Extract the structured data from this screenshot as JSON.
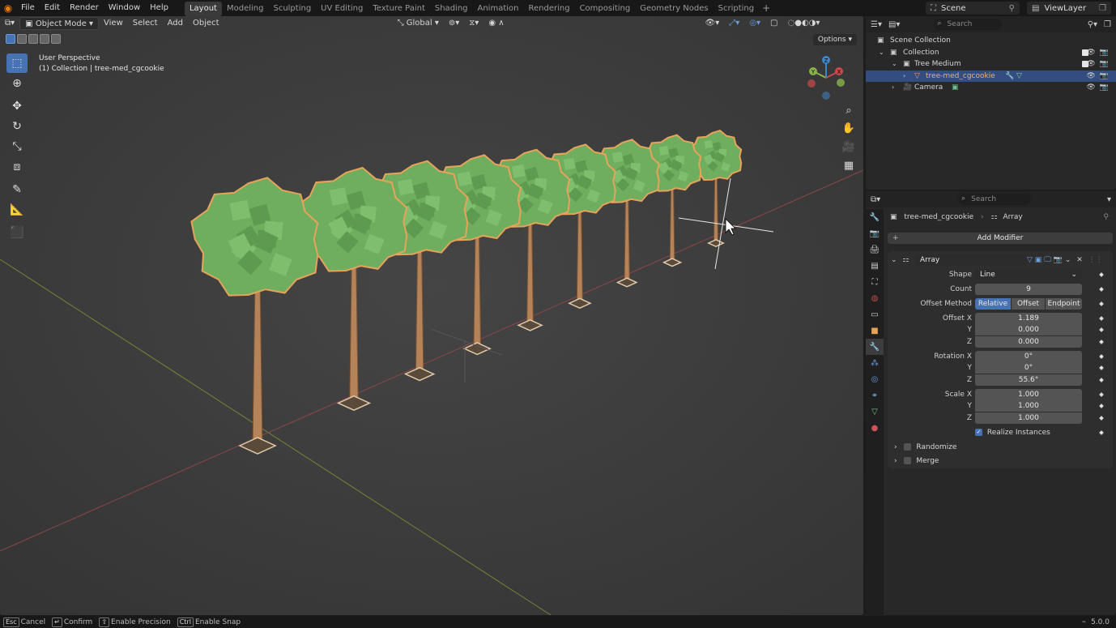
{
  "topbar": {
    "menus": [
      "File",
      "Edit",
      "Render",
      "Window",
      "Help"
    ],
    "workspaces": [
      "Layout",
      "Modeling",
      "Sculpting",
      "UV Editing",
      "Texture Paint",
      "Shading",
      "Animation",
      "Rendering",
      "Compositing",
      "Geometry Nodes",
      "Scripting"
    ],
    "active_workspace": "Layout",
    "add_symbol": "+",
    "scene": "Scene",
    "view_layer": "ViewLayer"
  },
  "viewport": {
    "mode": "Object Mode",
    "menus": [
      "View",
      "Select",
      "Add",
      "Object"
    ],
    "transform_orientation": "Global",
    "options": "Options",
    "info_line1": "User Perspective",
    "info_line2": "(1) Collection | tree-med_cgcookie",
    "gizmo_axes": [
      "X",
      "Y",
      "Z"
    ]
  },
  "outliner": {
    "search_placeholder": "Search",
    "rows": [
      {
        "label": "Scene Collection"
      },
      {
        "label": "Collection"
      },
      {
        "label": "Tree Medium"
      },
      {
        "label": "tree-med_cgcookie"
      },
      {
        "label": "Camera"
      }
    ]
  },
  "properties": {
    "search_placeholder": "Search",
    "breadcrumb_object": "tree-med_cgcookie",
    "breadcrumb_modifier": "Array",
    "add_modifier": "Add Modifier",
    "modifier_name": "Array",
    "shape_label": "Shape",
    "shape_value": "Line",
    "count_label": "Count",
    "count_value": "9",
    "offset_method_label": "Offset Method",
    "offset_methods": [
      "Relative",
      "Offset",
      "Endpoint"
    ],
    "offset_label_x": "Offset X",
    "offset_x": "1.189",
    "offset_y": "0.000",
    "offset_z": "0.000",
    "rotation_label_x": "Rotation X",
    "rotation_x": "0°",
    "rotation_y": "0°",
    "rotation_z": "55.6°",
    "scale_label_x": "Scale X",
    "scale_x": "1.000",
    "scale_y": "1.000",
    "scale_z": "1.000",
    "axis_y": "Y",
    "axis_z": "Z",
    "realize_instances": "Realize Instances",
    "randomize": "Randomize",
    "merge": "Merge"
  },
  "statusbar": {
    "items": [
      {
        "key": "Esc",
        "label": "Cancel"
      },
      {
        "key": "↵",
        "label": "Confirm"
      },
      {
        "key": "⇧",
        "label": "Enable Precision"
      },
      {
        "key": "Ctrl",
        "label": "Enable Snap"
      }
    ],
    "version": "5.0.0"
  },
  "colors": {
    "accent": "#4772b3",
    "foliage": "#6fae5e",
    "trunk": "#b5835a",
    "x_axis": "#c94a4a",
    "y_axis": "#8ab34a",
    "z_axis": "#3f86c9"
  }
}
